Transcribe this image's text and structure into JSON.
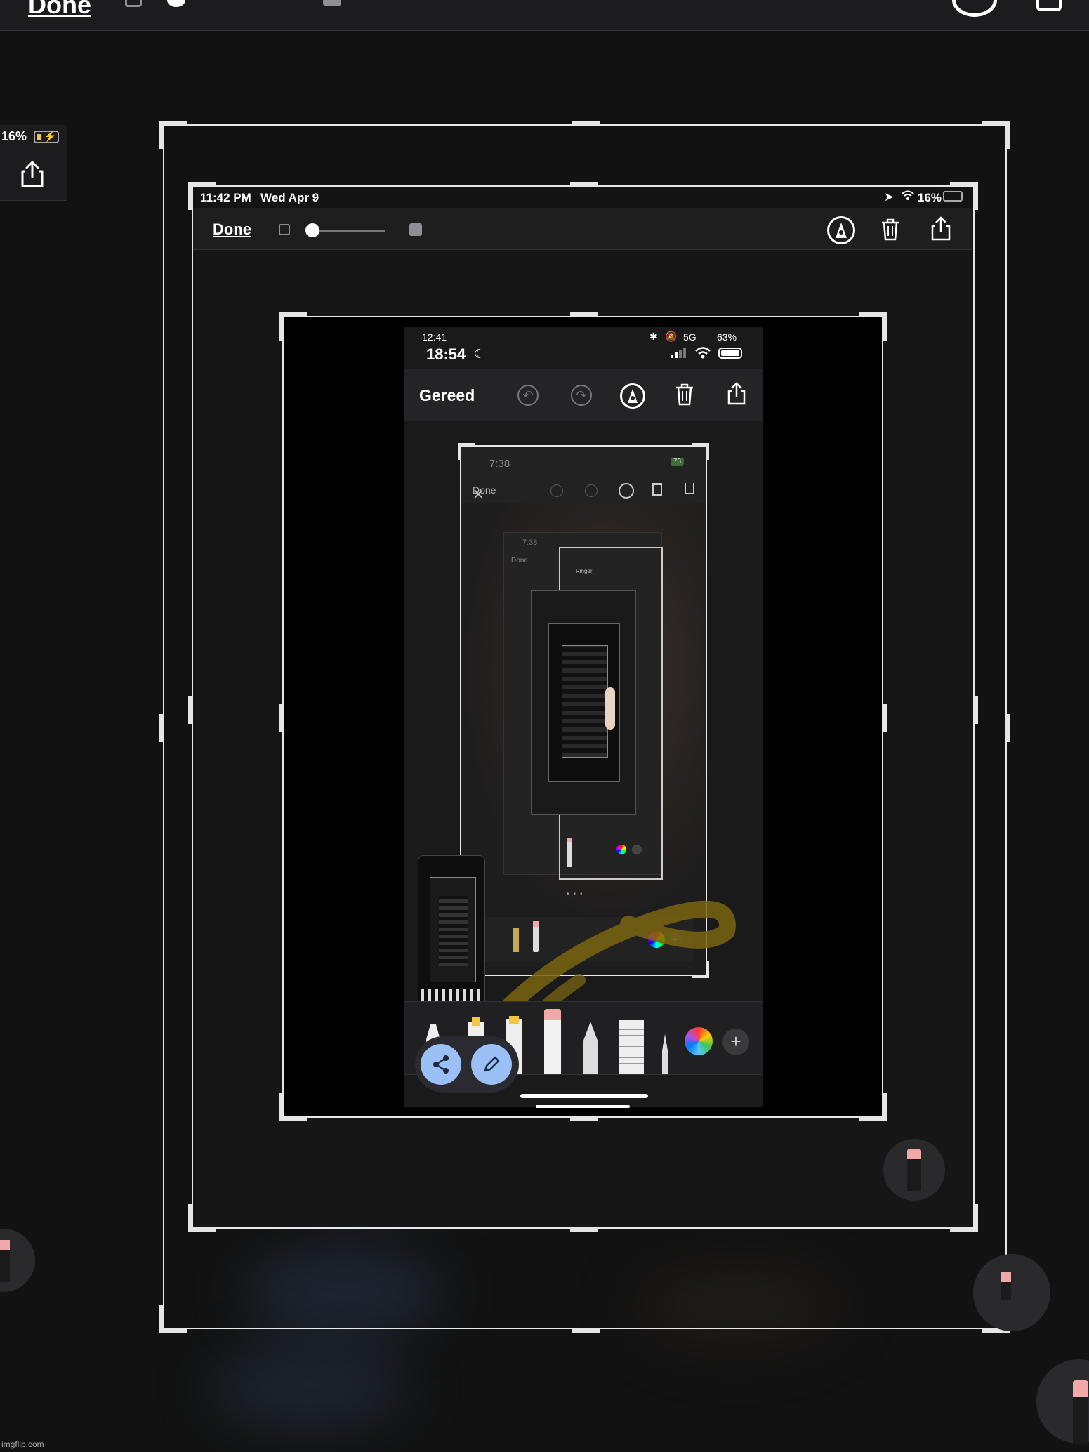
{
  "outer": {
    "done_label": "Done",
    "battery": "16%"
  },
  "ipad": {
    "time": "11:42 PM",
    "date": "Wed Apr 9",
    "battery": "16%",
    "done_label": "Done"
  },
  "phone": {
    "status_time": "12:41",
    "network": "5G",
    "battery": "63%",
    "clock": "18:54",
    "done_label": "Gereed",
    "inner_time": "7:38",
    "inner_done": "Done",
    "inner_battery": "73",
    "nested_time": "7:38",
    "nested_done": "Done",
    "nested_ringer": "Ringer"
  },
  "watermark": "imgflip.com",
  "colors": {
    "background": "#121212",
    "fab": "#9ac0f5",
    "highlight": "#7a6410",
    "eraser_tip": "#f0a8a8"
  }
}
